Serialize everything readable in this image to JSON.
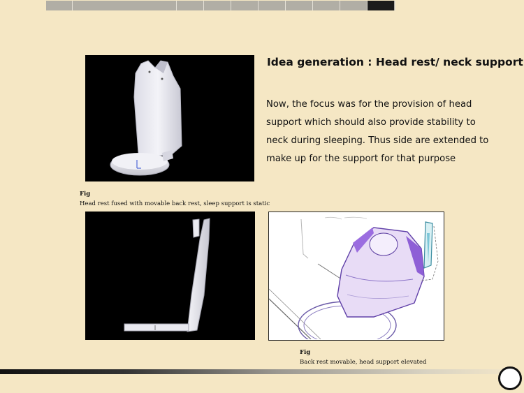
{
  "navigation": {
    "tab_count": 12,
    "active_tab_index": 11
  },
  "slide": {
    "title": "Idea generation : Head rest/ neck support",
    "body": "Now, the focus was for the provision of head support which should also provide stability to neck during sleeping. Thus side are extended to make up for the support for that purpose"
  },
  "figures": {
    "top_left": {
      "fig_label": "Fig",
      "caption": "Head rest fused with  movable back rest, sleep support is static"
    },
    "bottom_right": {
      "fig_label": "Fig",
      "caption": "Back rest movable, head support elevated"
    }
  },
  "colors": {
    "background": "#f5e7c4",
    "nav_tab": "#b1aea5",
    "nav_tab_active": "#1b1b1b",
    "render_background": "#000000",
    "sketch_accent": "#8a5fd6"
  },
  "icons": {
    "next_slide": "circle-icon"
  }
}
